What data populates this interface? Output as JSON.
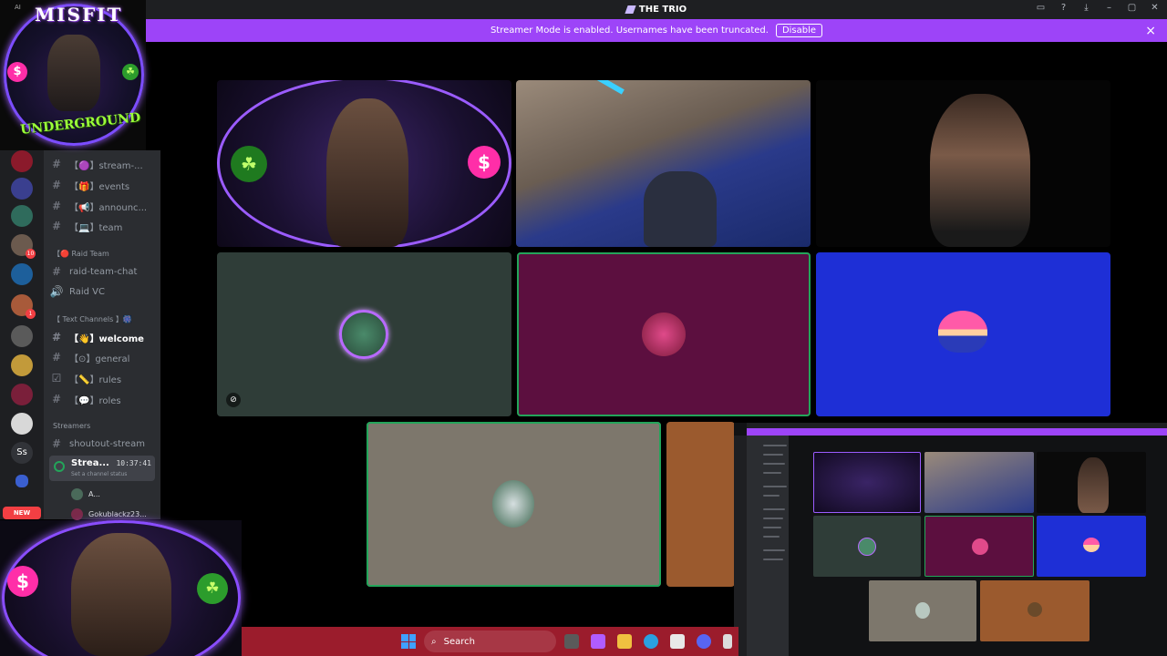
{
  "window": {
    "title": "THE TRIO"
  },
  "banner": {
    "text": "Streamer Mode is enabled. Usernames have been truncated.",
    "button": "Disable"
  },
  "logo": {
    "top_text": "MISFIT",
    "bottom_text": "UNDERGROUND",
    "ai_tag": "AI"
  },
  "channels": {
    "items": [
      {
        "label": "【🟣】stream-...",
        "style": "normal"
      },
      {
        "label": "【🎁】events",
        "style": "normal"
      },
      {
        "label": "【📢】announc...",
        "style": "normal"
      },
      {
        "label": "【💻】team",
        "style": "normal"
      }
    ],
    "raid_category": "【🔴 Raid Team",
    "raid_items": [
      "raid-team-chat",
      "Raid VC"
    ],
    "text_category": "【 Text Channels 】🎆",
    "text_items": [
      "【👋】welcome",
      "【⊙】general",
      "【📏】rules",
      "【💬】roles"
    ],
    "streamers_category": "Streamers",
    "shoutout": "shoutout-stream",
    "voice": {
      "name": "Strea...",
      "time": "10:37:41",
      "status": "Set a channel status"
    },
    "members": [
      "A...",
      "Gokublackz23..."
    ]
  },
  "rail": {
    "new_badge": "NEW",
    "ss_label": "Ss",
    "badge_counts": [
      "10",
      "1"
    ]
  },
  "taskbar": {
    "search": "Search"
  },
  "cam": {
    "symbol_left": "$",
    "symbol_right": "☘"
  },
  "colors": {
    "discord_bg": "#2b2d31",
    "banner_purple": "#9d44f8",
    "speaking_green": "#23a55a",
    "tile_slate": "#2f3d38",
    "tile_maroon": "#5c0f3f",
    "tile_blue": "#1e2fd6",
    "tile_taupe": "#7d776c",
    "tile_brown": "#9b5a2e"
  }
}
